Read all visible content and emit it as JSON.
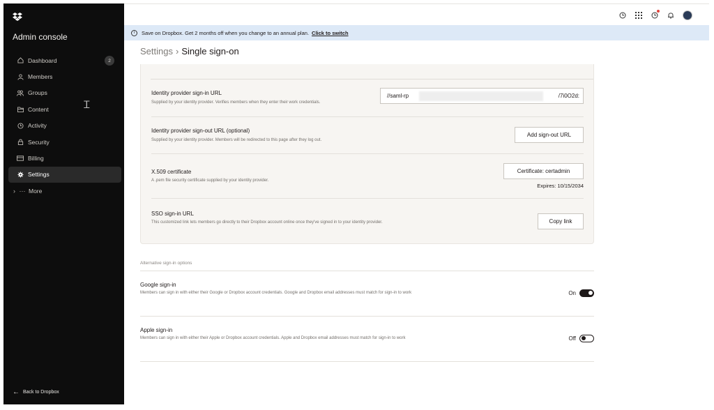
{
  "sidebar": {
    "title": "Admin console",
    "items": [
      {
        "label": "Dashboard",
        "icon": "home-icon",
        "badge": "2"
      },
      {
        "label": "Members",
        "icon": "person-icon"
      },
      {
        "label": "Groups",
        "icon": "group-icon"
      },
      {
        "label": "Content",
        "icon": "folder-icon"
      },
      {
        "label": "Activity",
        "icon": "clock-icon"
      },
      {
        "label": "Security",
        "icon": "lock-icon"
      },
      {
        "label": "Billing",
        "icon": "card-icon"
      },
      {
        "label": "Settings",
        "icon": "gear-icon",
        "active": true
      },
      {
        "label": "More",
        "icon": "ellipsis-icon"
      }
    ],
    "back_label": "Back to Dropbox"
  },
  "banner": {
    "text": "Save on Dropbox. Get 2 months off when you change to an annual plan.",
    "link": "Click to switch"
  },
  "breadcrumb": {
    "parent": "Settings",
    "separator": "›",
    "current": "Single sign-on"
  },
  "sso": {
    "signin_url": {
      "title": "Identity provider sign-in URL",
      "desc": "Supplied by your identity provider. Verifies members when they enter their work credentials.",
      "value_start": "//saml-rp",
      "value_end": "/7i0O2d:"
    },
    "signout_url": {
      "title": "Identity provider sign-out URL (optional)",
      "desc": "Supplied by your identity provider. Members will be redirected to this page after they log out.",
      "button": "Add sign-out URL"
    },
    "certificate": {
      "title": "X.509 certificate",
      "desc": "A .pem file security certificate supplied by your identity provider.",
      "button": "Certificate: certadmin",
      "expires": "Expires: 10/15/2034"
    },
    "sso_link": {
      "title": "SSO sign-in URL",
      "desc": "This customized link lets members go directly to their Dropbox account online once they've signed in to your identity provider.",
      "button": "Copy link"
    }
  },
  "alternative": {
    "label": "Alternative sign-in options",
    "google": {
      "title": "Google sign-in",
      "desc": "Members can sign in with either their Google or Dropbox account credentials. Google and Dropbox email addresses must match for sign-in to work",
      "state": "On"
    },
    "apple": {
      "title": "Apple sign-in",
      "desc": "Members can sign in with either their Apple or Dropbox account credentials. Apple and Dropbox email addresses must match for sign-in to work",
      "state": "Off"
    }
  },
  "colors": {
    "sidebar_bg": "#0d0d0d",
    "banner_bg": "#dde9f7",
    "card_bg": "#f7f5f2",
    "notification_dot": "#e0413a"
  }
}
